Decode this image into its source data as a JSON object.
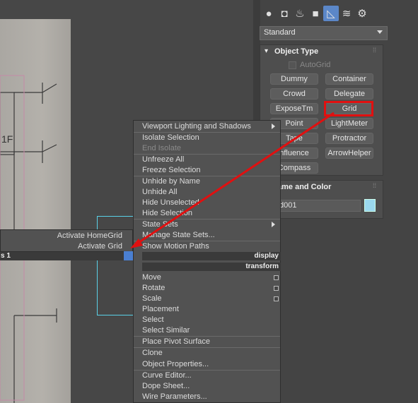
{
  "command_panel": {
    "tabs": [
      "geometry-icon",
      "shapes-icon",
      "lights-icon",
      "cameras-icon",
      "helpers-icon",
      "spacewarps-icon",
      "systems-icon"
    ],
    "category_dropdown": "Standard",
    "object_type": {
      "title": "Object Type",
      "autogrid_label": "AutoGrid",
      "buttons": [
        "Dummy",
        "Container",
        "Crowd",
        "Delegate",
        "ExposeTm",
        "Grid",
        "Point",
        "LightMeter",
        "Tape",
        "Protractor",
        "nfluence",
        "ArrowHelper",
        "Compass"
      ]
    },
    "name_and_color": {
      "title": "ame and Color",
      "name_value": "d001",
      "swatch_color": "#9ad8ee"
    }
  },
  "quad_menu": {
    "right_items_top": [
      "Viewport Lighting and Shadows",
      "Isolate Selection",
      "End Isolate",
      "Unfreeze All",
      "Freeze Selection",
      "Unhide by Name",
      "Unhide All",
      "Hide Unselected",
      "Hide Selection",
      "State Sets",
      "Manage State Sets...",
      "Show Motion Paths"
    ],
    "display_header": "display",
    "transform_header": "transform",
    "right_items_bottom": [
      "Move",
      "Rotate",
      "Scale",
      "Placement",
      "Select",
      "Select Similar",
      "Place Pivot Surface",
      "Clone",
      "Object Properties...",
      "Curve Editor...",
      "Dope Sheet...",
      "Wire Parameters..."
    ],
    "left_items": [
      "Activate HomeGrid",
      "Activate Grid"
    ],
    "left_header": "s 1"
  },
  "annotation": {
    "highlight_color": "#e01010"
  }
}
